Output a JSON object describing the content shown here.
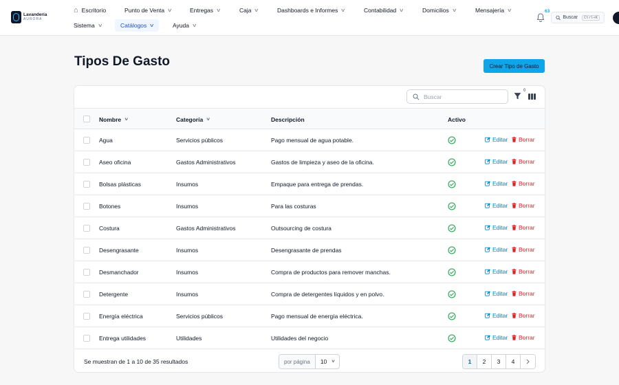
{
  "brand": {
    "name_line1": "Lavandería",
    "name_line2": "AURORA"
  },
  "nav": {
    "row1": [
      "Escritorio",
      "Punto de Venta",
      "Entregas",
      "Caja",
      "Dashboards e Informes",
      "Contabilidad",
      "Domicilios",
      "Mensajería"
    ],
    "row2": [
      "Sistema",
      "Catálogos",
      "Ayuda"
    ],
    "active": "Catálogos"
  },
  "notifications": {
    "count": "63"
  },
  "global_search": {
    "label": "Buscar",
    "shortcut": "Ctrl+K"
  },
  "page": {
    "title": "Tipos De Gasto",
    "create_label": "Crear Tipo de Gasto"
  },
  "table": {
    "search_placeholder": "Buscar",
    "filter_count": "0",
    "columns": [
      "Nombre",
      "Categoría",
      "Descripción",
      "Activo"
    ],
    "edit_label": "Editar",
    "delete_label": "Borrar",
    "rows": [
      {
        "nombre": "Agua",
        "categoria": "Servicios públicos",
        "descripcion": "Pago mensual de agua potable.",
        "activo": true
      },
      {
        "nombre": "Aseo oficina",
        "categoria": "Gastos Administrativos",
        "descripcion": "Gastos de limpieza y aseo de la oficina.",
        "activo": true
      },
      {
        "nombre": "Bolsas plásticas",
        "categoria": "Insumos",
        "descripcion": "Empaque para entrega de prendas.",
        "activo": true
      },
      {
        "nombre": "Botones",
        "categoria": "Insumos",
        "descripcion": "Para las costuras",
        "activo": true
      },
      {
        "nombre": "Costura",
        "categoria": "Gastos Administrativos",
        "descripcion": "Outsourcing de costura",
        "activo": true
      },
      {
        "nombre": "Desengrasante",
        "categoria": "Insumos",
        "descripcion": "Desengrasante de prendas",
        "activo": true
      },
      {
        "nombre": "Desmanchador",
        "categoria": "Insumos",
        "descripcion": "Compra de productos para remover manchas.",
        "activo": true
      },
      {
        "nombre": "Detergente",
        "categoria": "Insumos",
        "descripcion": "Compra de detergentes líquidos y en polvo.",
        "activo": true
      },
      {
        "nombre": "Energía eléctrica",
        "categoria": "Servicios públicos",
        "descripcion": "Pago mensual de energía eléctrica.",
        "activo": true
      },
      {
        "nombre": "Entrega utilidades",
        "categoria": "Utilidades",
        "descripcion": "Utilidades del negocio",
        "activo": true
      }
    ]
  },
  "footer": {
    "results_text": "Se muestran de 1 a 10 de 35 resultados",
    "per_page_label": "por página",
    "per_page_value": "10",
    "pages": [
      "1",
      "2",
      "3",
      "4"
    ],
    "current_page": "1"
  },
  "colors": {
    "accent": "#0ea5e9",
    "success": "#16a34a",
    "danger": "#dc2626",
    "link": "#0284c7"
  }
}
